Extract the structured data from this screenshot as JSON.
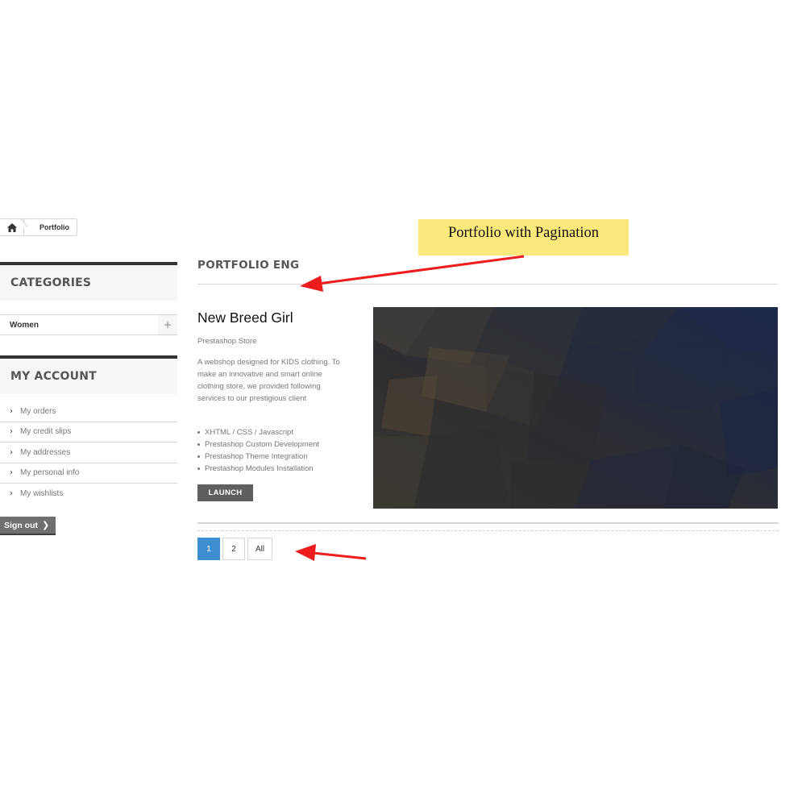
{
  "breadcrumb": {
    "home_icon": "home-icon",
    "current": "Portfolio"
  },
  "sidebar": {
    "categories_title": "CATEGORIES",
    "categories": [
      {
        "label": "Women",
        "toggle": "+"
      }
    ],
    "account_title": "MY ACCOUNT",
    "account_links": [
      {
        "label": "My orders"
      },
      {
        "label": "My credit slips"
      },
      {
        "label": "My addresses"
      },
      {
        "label": "My personal info"
      },
      {
        "label": "My wishlists"
      }
    ],
    "signout_label": "Sign out"
  },
  "main": {
    "heading": "PORTFOLIO ENG",
    "item": {
      "title": "New Breed Girl",
      "subtitle": "Prestashop Store",
      "description": "A webshop designed for KIDS clothing. To make an innovative and smart online clothing store, we provided following services to our prestigious client",
      "features": [
        "XHTML / CSS / Javascript",
        "Prestashop Custom Development",
        "Prestashop Theme Integration",
        "Prestashop Modules Installation"
      ],
      "launch_label": "LAUNCH"
    },
    "pagination": {
      "pages": [
        "1",
        "2",
        "All"
      ],
      "active": "1"
    }
  },
  "annotation": {
    "label": "Portfolio with Pagination"
  },
  "colors": {
    "accent": "#3d8ed1",
    "annotation_bg": "#fde97b",
    "arrow": "#ee1c1c",
    "button_dark": "#5f5f5f"
  }
}
